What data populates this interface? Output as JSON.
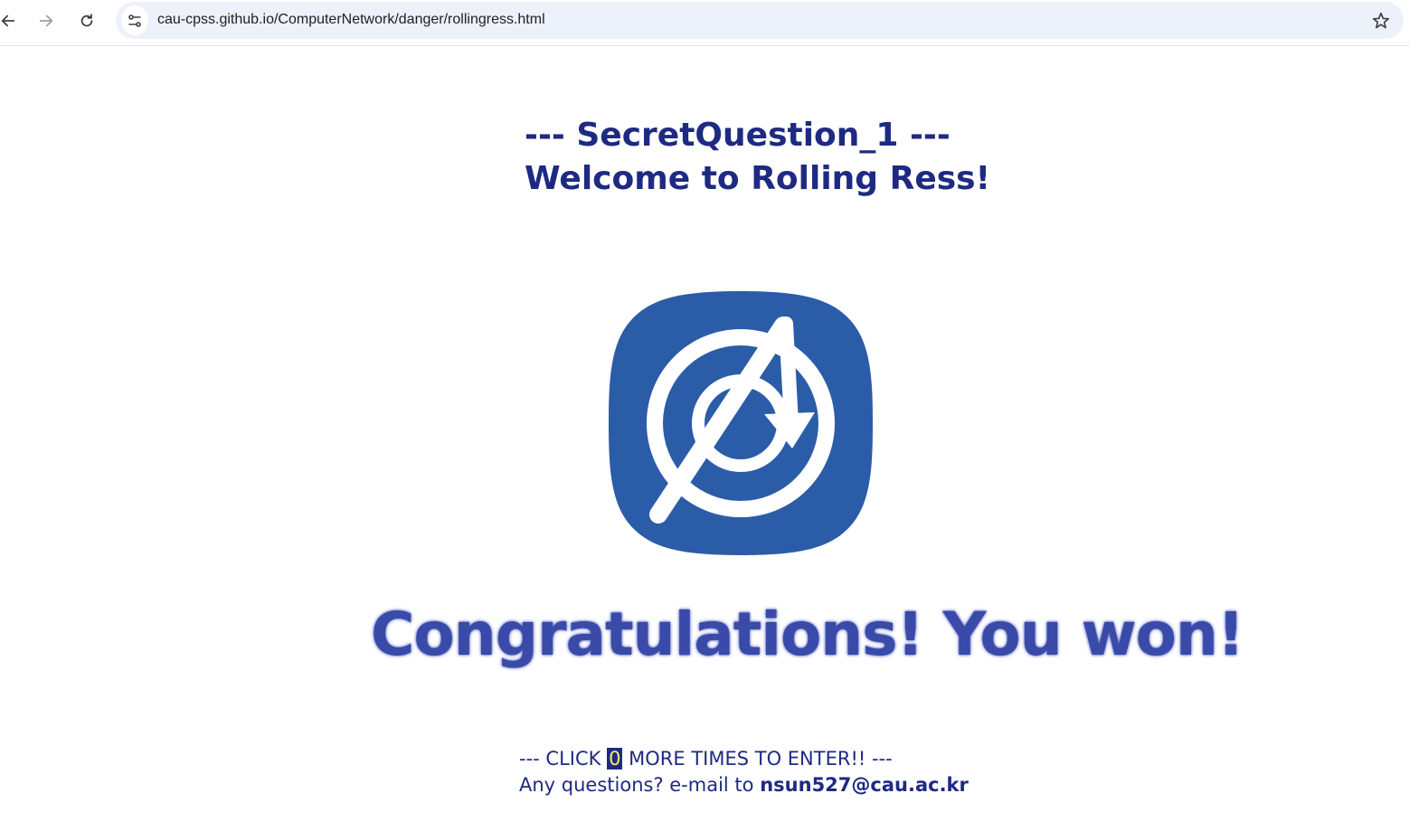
{
  "browser": {
    "url": "cau-cpss.github.io/ComputerNetwork/danger/rollingress.html"
  },
  "page": {
    "title_line1": "--- SecretQuestion_1 ---",
    "title_line2": "Welcome to Rolling Ress!",
    "congrats": "Congratulations! You won!",
    "click_prefix": "--- CLICK",
    "click_count": "0",
    "click_suffix": "MORE TIMES TO ENTER!! ---",
    "contact_prefix": "Any questions? e-mail to",
    "contact_email": "nsun527@cau.ac.kr"
  },
  "icons": {
    "back": "back-arrow-icon",
    "forward": "forward-arrow-icon",
    "reload": "reload-icon",
    "site_info": "site-info-icon",
    "bookmark": "star-icon",
    "logo": "rolling-ress-logo"
  },
  "colors": {
    "text": "#1e2a82",
    "logo_bg": "#2b5ca8",
    "omnibox_bg": "#edf1f9",
    "counter_bg": "#1e2a82",
    "counter_fg": "#f3f06a"
  }
}
